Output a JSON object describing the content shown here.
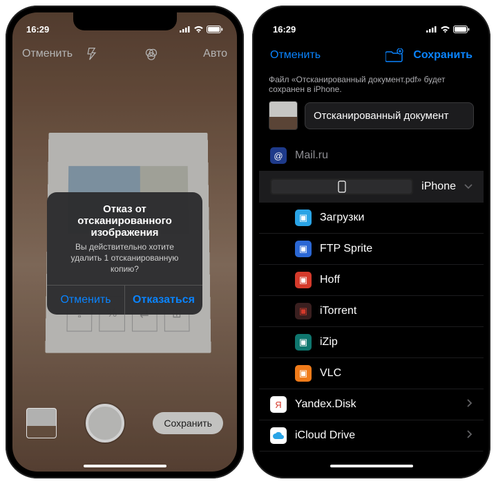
{
  "status": {
    "time": "16:29"
  },
  "phone1": {
    "cancel": "Отменить",
    "auto": "Авто",
    "alert": {
      "title": "Отказ от отсканированного изображения",
      "message": "Вы действительно хотите удалить 1 отсканированную копию?",
      "cancel": "Отменить",
      "discard": "Отказаться"
    },
    "save": "Сохранить"
  },
  "phone2": {
    "cancel": "Отменить",
    "save": "Сохранить",
    "info": "Файл «Отсканированный документ.pdf» будет сохранен в iPhone.",
    "doc_name": "Отсканированный документ",
    "locations": {
      "mail": "Mail.ru",
      "iphone": "iPhone",
      "folders": [
        {
          "label": "Загрузки",
          "icon": "cyan"
        },
        {
          "label": "FTP Sprite",
          "icon": "blue"
        },
        {
          "label": "Hoff",
          "icon": "red"
        },
        {
          "label": "iTorrent",
          "icon": "darkred"
        },
        {
          "label": "iZip",
          "icon": "teal"
        },
        {
          "label": "VLC",
          "icon": "orange"
        }
      ],
      "yandex": "Yandex.Disk",
      "icloud": "iCloud Drive"
    }
  }
}
